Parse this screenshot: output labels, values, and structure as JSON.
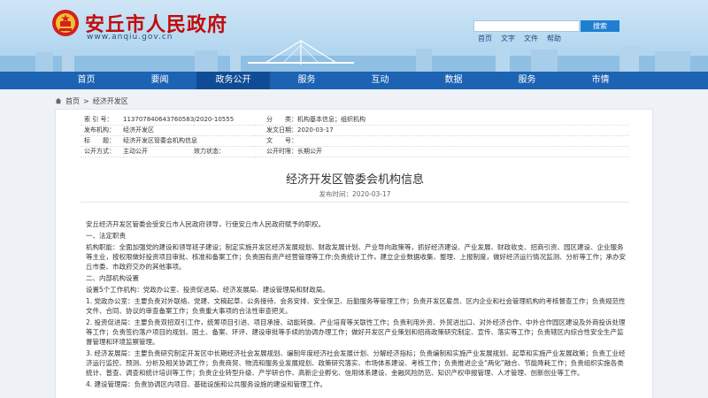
{
  "header": {
    "title": "安丘市人民政府",
    "url": "www.anqiu.gov.cn",
    "search_button": "搜索",
    "quick_links": [
      "首页",
      "文字",
      "文件",
      "帮助"
    ]
  },
  "nav": {
    "items": [
      "首页",
      "要闻",
      "政务公开",
      "服务",
      "互动",
      "数据",
      "服务",
      "市情"
    ],
    "active_index": 2
  },
  "breadcrumb": {
    "home": "首页",
    "separator": ">",
    "current": "经济开发区"
  },
  "info": {
    "index_label": "索 引 号：",
    "index_value": "11370784064376058З/2020-10555",
    "category_label": "分　　类：",
    "category_value": "机构基本信息；组织机构",
    "publisher_label": "发布机构：",
    "publisher_value": "经济开发区",
    "date_label": "发文日期：",
    "date_value": "2020-03-17",
    "name_label": "标　　题：",
    "name_value": "经济开发区管委会机构信息",
    "docno_label": "文　　号：",
    "docno_value": "",
    "mode_label": "公开方式：",
    "mode_value": "主动公开",
    "status_label": "效力状态：",
    "status_value": "",
    "period_label": "公开时限：",
    "period_value": "长期公开"
  },
  "article": {
    "title": "经济开发区管委会机构信息",
    "date": "发布时间：2020-03-17",
    "paragraphs": [
      "安丘经济开发区管委会受安丘市人民政府领导，行使安丘市人民政府赋予的职权。",
      "一、法定职责",
      "机构职能：全面加强党的建设和领导班子建设；制定实施开发区经济发展规划、财政发展计划、产业导向政策等，抓好经济建设、产业发展、财政收支、招商引资、园区建设、企业服务等主业，按权限做好投资项目审批、核准和备案工作；负责国有资产经营管理等工作;负责统计工作，建立企业数据收集、整理、上报制度，做好经济运行情况监测、分析等工作；承办安丘市委、市政府交办的其他事项。",
      "二、内部机构设置",
      "设置5个工作机构：党政办公室、投资促进局、经济发展局、建设管理局和财政局。",
      "1. 党政办公室：主要负责对外联络、党建、文稿起草、公务接待、会务安排、安全保卫、后勤服务等管理工作；负责开发区雇员、区内企业和社会管理机构的考核督查工作；负责规范性文件、合同、协议的审查备案工作；负责重大事项的合法性审查把关。",
      "2. 投资促进局：主要负责双招双引工作，统筹项目引进、项目承接、动能转换、产业培育等关联性工作；负责利用外资、外贸进出口、对外经济合作、中外合作园区建设及外商投诉处理等工作；负责签约落户项目的规划、国土、备案、环评、建设审批等手续的协调办理工作；做好开发区产业策划和招商政策研究制定、宣传、落实等工作；负责辖区内综合性安全生产监督管理和环境监察管理。",
      "3. 经济发展局：主要负责研究制定开发区中长期经济社会发展规划、编制年度经济社会发展计划、分解经济指标；负责编制和实施产业发展规划、起草和实施产业发展政策；负责工业经济运行监控、预测、分析及相关协调工作；负责商贸、物流和服务业发展规划、政策研究落实、市场体系建设、考核工作；负责推进企业“两化”融合、节能降耗工作；负责组织实施各类统计、普查、调查和统计培训等工作；负责企业转型升级、产学研合作、高新企业孵化、信用体系建设、金融风险防范、知识产权申报管理、人才管理、创新创业等工作。",
      "4. 建设管理局：负责协调区内项目、基础设施和公共服务设施的建设和管理工作。"
    ]
  },
  "colors": {
    "nav_bg": "#1d63b3",
    "nav_active": "#0f4c95",
    "title_red": "#c20b0b"
  }
}
